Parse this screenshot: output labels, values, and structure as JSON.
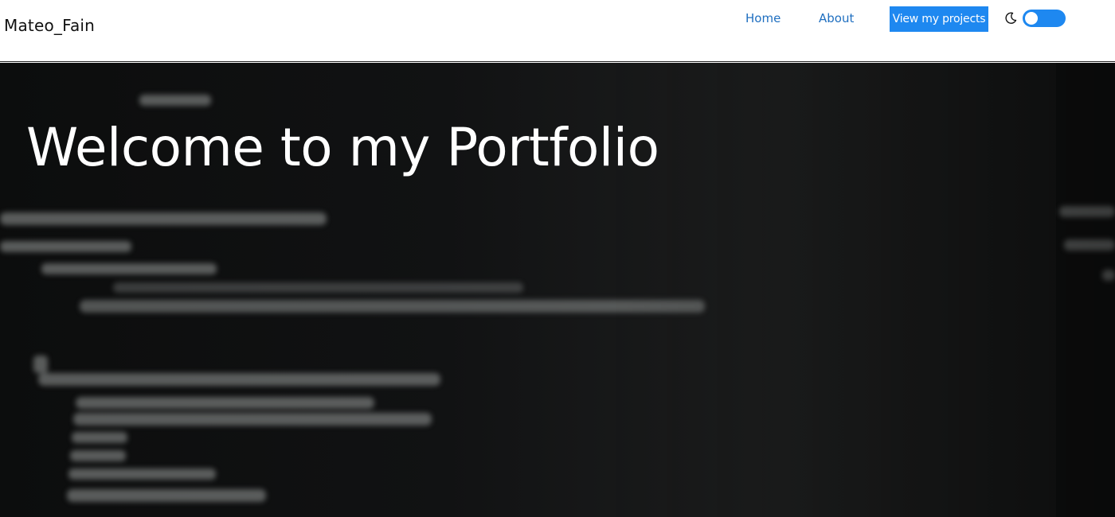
{
  "navbar": {
    "brand": "Mateo_Fain",
    "links": [
      {
        "label": "Home"
      },
      {
        "label": "About"
      }
    ],
    "cta_label": "View my projects",
    "theme_toggle": {
      "icon": "moon-icon",
      "state": "off"
    }
  },
  "hero": {
    "title": "Welcome to my Portfolio"
  },
  "colors": {
    "accent": "#1e88f0",
    "link": "#1f6fc0",
    "hero_bg": "#111213"
  }
}
